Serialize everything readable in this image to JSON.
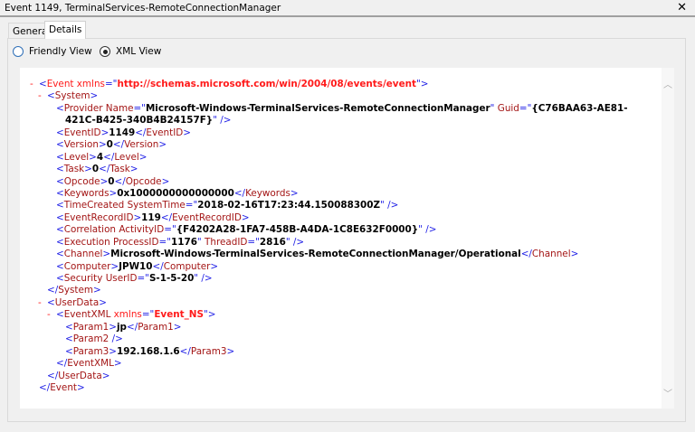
{
  "window": {
    "title": "Event 1149, TerminalServices-RemoteConnectionManager",
    "close_icon": "close-icon"
  },
  "tabs": [
    {
      "label": "General",
      "active": false
    },
    {
      "label": "Details",
      "active": true
    }
  ],
  "view_options": [
    {
      "label": "Friendly View",
      "selected": false
    },
    {
      "label": "XML View",
      "selected": true
    }
  ],
  "colors": {
    "bracket": "#1e1ee6",
    "name": "#a31515",
    "ns": "#ff1a1a",
    "value": "#000000"
  },
  "xml_lines": [
    {
      "level": 0,
      "toggle": "-",
      "segs": [
        [
          "b",
          "<"
        ],
        [
          "r",
          "Event xmlns"
        ],
        [
          "b",
          "=\""
        ],
        [
          "rv",
          "http://schemas.microsoft.com/win/2004/08/events/event"
        ],
        [
          "b",
          "\">"
        ]
      ]
    },
    {
      "level": 1,
      "toggle": "-",
      "segs": [
        [
          "b",
          "<"
        ],
        [
          "n",
          "System"
        ],
        [
          "b",
          ">"
        ]
      ]
    },
    {
      "level": 2,
      "segs": [
        [
          "b",
          "<"
        ],
        [
          "n",
          "Provider Name"
        ],
        [
          "b",
          "=\""
        ],
        [
          "v",
          "Microsoft-Windows-TerminalServices-RemoteConnectionManager"
        ],
        [
          "b",
          "\" "
        ],
        [
          "n",
          "Guid"
        ],
        [
          "b",
          "=\""
        ],
        [
          "v",
          "{C76BAA63-AE81-"
        ]
      ]
    },
    {
      "level": 3,
      "segs": [
        [
          "v",
          "421C-B425-340B4B24157F}"
        ],
        [
          "b",
          "\" />"
        ]
      ]
    },
    {
      "level": 2,
      "segs": [
        [
          "b",
          "<"
        ],
        [
          "n",
          "EventID"
        ],
        [
          "b",
          ">"
        ],
        [
          "v",
          "1149"
        ],
        [
          "b",
          "</"
        ],
        [
          "n",
          "EventID"
        ],
        [
          "b",
          ">"
        ]
      ]
    },
    {
      "level": 2,
      "segs": [
        [
          "b",
          "<"
        ],
        [
          "n",
          "Version"
        ],
        [
          "b",
          ">"
        ],
        [
          "v",
          "0"
        ],
        [
          "b",
          "</"
        ],
        [
          "n",
          "Version"
        ],
        [
          "b",
          ">"
        ]
      ]
    },
    {
      "level": 2,
      "segs": [
        [
          "b",
          "<"
        ],
        [
          "n",
          "Level"
        ],
        [
          "b",
          ">"
        ],
        [
          "v",
          "4"
        ],
        [
          "b",
          "</"
        ],
        [
          "n",
          "Level"
        ],
        [
          "b",
          ">"
        ]
      ]
    },
    {
      "level": 2,
      "segs": [
        [
          "b",
          "<"
        ],
        [
          "n",
          "Task"
        ],
        [
          "b",
          ">"
        ],
        [
          "v",
          "0"
        ],
        [
          "b",
          "</"
        ],
        [
          "n",
          "Task"
        ],
        [
          "b",
          ">"
        ]
      ]
    },
    {
      "level": 2,
      "segs": [
        [
          "b",
          "<"
        ],
        [
          "n",
          "Opcode"
        ],
        [
          "b",
          ">"
        ],
        [
          "v",
          "0"
        ],
        [
          "b",
          "</"
        ],
        [
          "n",
          "Opcode"
        ],
        [
          "b",
          ">"
        ]
      ]
    },
    {
      "level": 2,
      "segs": [
        [
          "b",
          "<"
        ],
        [
          "n",
          "Keywords"
        ],
        [
          "b",
          ">"
        ],
        [
          "v",
          "0x1000000000000000"
        ],
        [
          "b",
          "</"
        ],
        [
          "n",
          "Keywords"
        ],
        [
          "b",
          ">"
        ]
      ]
    },
    {
      "level": 2,
      "segs": [
        [
          "b",
          "<"
        ],
        [
          "n",
          "TimeCreated SystemTime"
        ],
        [
          "b",
          "=\""
        ],
        [
          "v",
          "2018-02-16T17:23:44.150088300Z"
        ],
        [
          "b",
          "\" />"
        ]
      ]
    },
    {
      "level": 2,
      "segs": [
        [
          "b",
          "<"
        ],
        [
          "n",
          "EventRecordID"
        ],
        [
          "b",
          ">"
        ],
        [
          "v",
          "119"
        ],
        [
          "b",
          "</"
        ],
        [
          "n",
          "EventRecordID"
        ],
        [
          "b",
          ">"
        ]
      ]
    },
    {
      "level": 2,
      "segs": [
        [
          "b",
          "<"
        ],
        [
          "n",
          "Correlation ActivityID"
        ],
        [
          "b",
          "=\""
        ],
        [
          "v",
          "{F4202A28-1FA7-458B-A4DA-1C8E632F0000}"
        ],
        [
          "b",
          "\" />"
        ]
      ]
    },
    {
      "level": 2,
      "segs": [
        [
          "b",
          "<"
        ],
        [
          "n",
          "Execution ProcessID"
        ],
        [
          "b",
          "=\""
        ],
        [
          "v",
          "1176"
        ],
        [
          "b",
          "\" "
        ],
        [
          "n",
          "ThreadID"
        ],
        [
          "b",
          "=\""
        ],
        [
          "v",
          "2816"
        ],
        [
          "b",
          "\" />"
        ]
      ]
    },
    {
      "level": 2,
      "segs": [
        [
          "b",
          "<"
        ],
        [
          "n",
          "Channel"
        ],
        [
          "b",
          ">"
        ],
        [
          "v",
          "Microsoft-Windows-TerminalServices-RemoteConnectionManager/Operational"
        ],
        [
          "b",
          "</"
        ],
        [
          "n",
          "Channel"
        ],
        [
          "b",
          ">"
        ]
      ]
    },
    {
      "level": 2,
      "segs": [
        [
          "b",
          "<"
        ],
        [
          "n",
          "Computer"
        ],
        [
          "b",
          ">"
        ],
        [
          "v",
          "JPW10"
        ],
        [
          "b",
          "</"
        ],
        [
          "n",
          "Computer"
        ],
        [
          "b",
          ">"
        ]
      ]
    },
    {
      "level": 2,
      "segs": [
        [
          "b",
          "<"
        ],
        [
          "n",
          "Security UserID"
        ],
        [
          "b",
          "=\""
        ],
        [
          "v",
          "S-1-5-20"
        ],
        [
          "b",
          "\" />"
        ]
      ]
    },
    {
      "level": 1,
      "segs": [
        [
          "b",
          "</"
        ],
        [
          "n",
          "System"
        ],
        [
          "b",
          ">"
        ]
      ]
    },
    {
      "level": 1,
      "toggle": "-",
      "segs": [
        [
          "b",
          "<"
        ],
        [
          "n",
          "UserData"
        ],
        [
          "b",
          ">"
        ]
      ]
    },
    {
      "level": 2,
      "toggle": "-",
      "segs": [
        [
          "b",
          "<"
        ],
        [
          "n",
          "EventXML"
        ],
        [
          "r",
          " xmlns"
        ],
        [
          "b",
          "=\""
        ],
        [
          "rv",
          "Event_NS"
        ],
        [
          "b",
          "\">"
        ]
      ]
    },
    {
      "level": 3,
      "segs": [
        [
          "b",
          "<"
        ],
        [
          "n",
          "Param1"
        ],
        [
          "b",
          ">"
        ],
        [
          "v",
          "jp"
        ],
        [
          "b",
          "</"
        ],
        [
          "n",
          "Param1"
        ],
        [
          "b",
          ">"
        ]
      ]
    },
    {
      "level": 3,
      "segs": [
        [
          "b",
          "<"
        ],
        [
          "n",
          "Param2"
        ],
        [
          "b",
          " />"
        ]
      ]
    },
    {
      "level": 3,
      "segs": [
        [
          "b",
          "<"
        ],
        [
          "n",
          "Param3"
        ],
        [
          "b",
          ">"
        ],
        [
          "v",
          "192.168.1.6"
        ],
        [
          "b",
          "</"
        ],
        [
          "n",
          "Param3"
        ],
        [
          "b",
          ">"
        ]
      ]
    },
    {
      "level": 2,
      "segs": [
        [
          "b",
          "</"
        ],
        [
          "n",
          "EventXML"
        ],
        [
          "b",
          ">"
        ]
      ]
    },
    {
      "level": 1,
      "segs": [
        [
          "b",
          "</"
        ],
        [
          "n",
          "UserData"
        ],
        [
          "b",
          ">"
        ]
      ]
    },
    {
      "level": 0,
      "segs": [
        [
          "b",
          "</"
        ],
        [
          "n",
          "Event"
        ],
        [
          "b",
          ">"
        ]
      ]
    }
  ]
}
